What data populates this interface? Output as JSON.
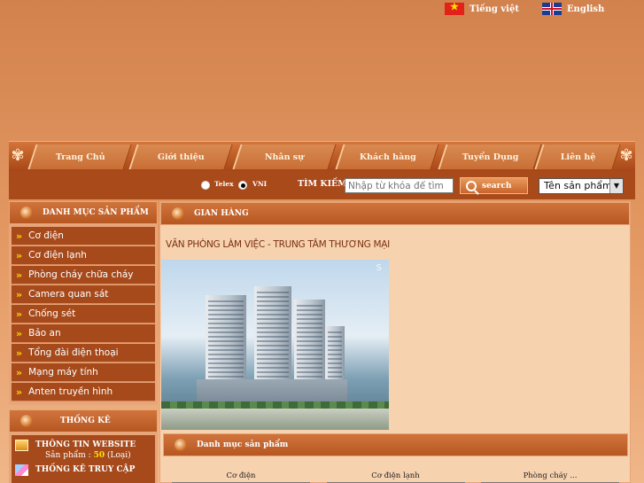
{
  "languages": [
    {
      "label": "Tiếng việt",
      "icon": "vietnam-flag-icon"
    },
    {
      "label": "English",
      "icon": "uk-flag-icon"
    }
  ],
  "nav": {
    "items": [
      "Trang Chủ",
      "Giới thiệu",
      "Nhân sự",
      "Khách hàng",
      "Tuyển Dụng",
      "Liên hệ"
    ]
  },
  "search": {
    "mode_telex": "Telex",
    "mode_vni": "VNI",
    "selected_mode": "VNI",
    "label": "TÌM KIẾM",
    "placeholder": "Nhập từ khóa để tìm",
    "button": "search",
    "select_value": "Tên sản phẩm"
  },
  "sidebar": {
    "categories_title": "DANH MỤC SẢN PHẨM",
    "categories": [
      "Cơ điện",
      "Cơ điện lạnh",
      "Phòng cháy chữa cháy",
      "Camera quan sát",
      "Chống sét",
      "Bảo an",
      "Tổng đài điện thoại",
      "Mạng máy tính",
      "Anten truyền hình"
    ],
    "stats_title": "THỐNG KÊ",
    "stats": {
      "website_info": "THÔNG TIN WEBSITE",
      "products_prefix": "Sản phẩm :",
      "products_count": "50",
      "products_suffix": "(Loại)",
      "access_stats": "THỐNG KÊ TRUY CẬP"
    }
  },
  "main": {
    "title": "GIAN HÀNG",
    "project_title": "VĂN PHÒNG LÀM VIỆC - TRUNG TÂM THƯƠNG MẠI",
    "photo_mark": "S",
    "sub_title": "Danh mục sản phẩm",
    "products": [
      "Cơ điện",
      "Cơ điện lạnh",
      "Phòng cháy ..."
    ]
  },
  "colors": {
    "accent": "#a94a1b",
    "highlight": "#ffd200"
  }
}
